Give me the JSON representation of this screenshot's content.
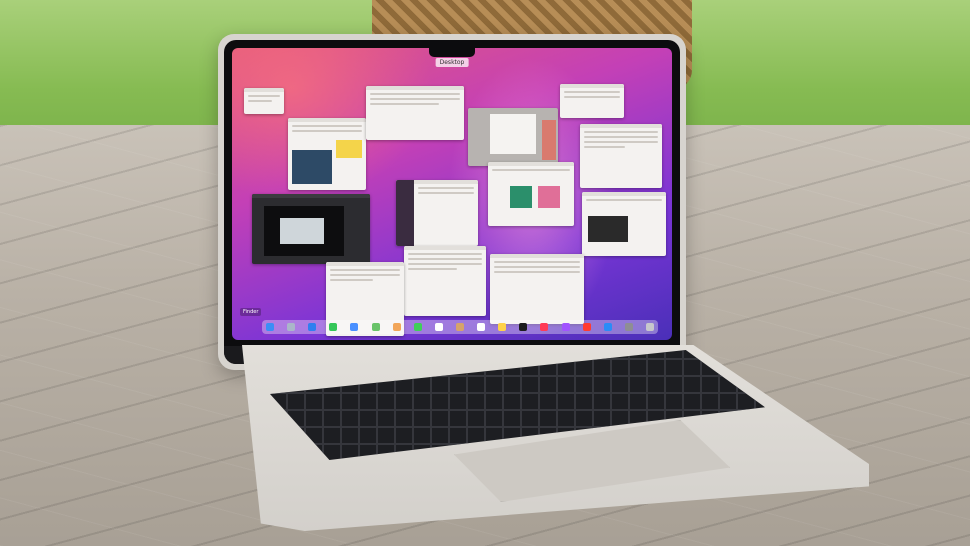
{
  "screen": {
    "menubar_label": "Desktop",
    "finder_label": "Finder"
  },
  "dock": {
    "icons": [
      "finder-icon",
      "launchpad-icon",
      "safari-icon",
      "messages-icon",
      "mail-icon",
      "maps-icon",
      "photos-icon",
      "facetime-icon",
      "calendar-icon",
      "contacts-icon",
      "reminders-icon",
      "notes-icon",
      "tv-icon",
      "music-icon",
      "podcasts-icon",
      "news-icon",
      "app-store-icon",
      "settings-icon",
      "trash-icon"
    ],
    "colors": [
      "#3a8ef6",
      "#aab6c9",
      "#2f7ff0",
      "#35c759",
      "#4a90ff",
      "#6ac46a",
      "#f2a65a",
      "#3fcf5a",
      "#ffffff",
      "#d6a36b",
      "#ffffff",
      "#ffd24a",
      "#1c1c1e",
      "#ff3b57",
      "#a254ff",
      "#ff3b30",
      "#2a8cf7",
      "#8e8e93",
      "#c7c7cc"
    ]
  }
}
